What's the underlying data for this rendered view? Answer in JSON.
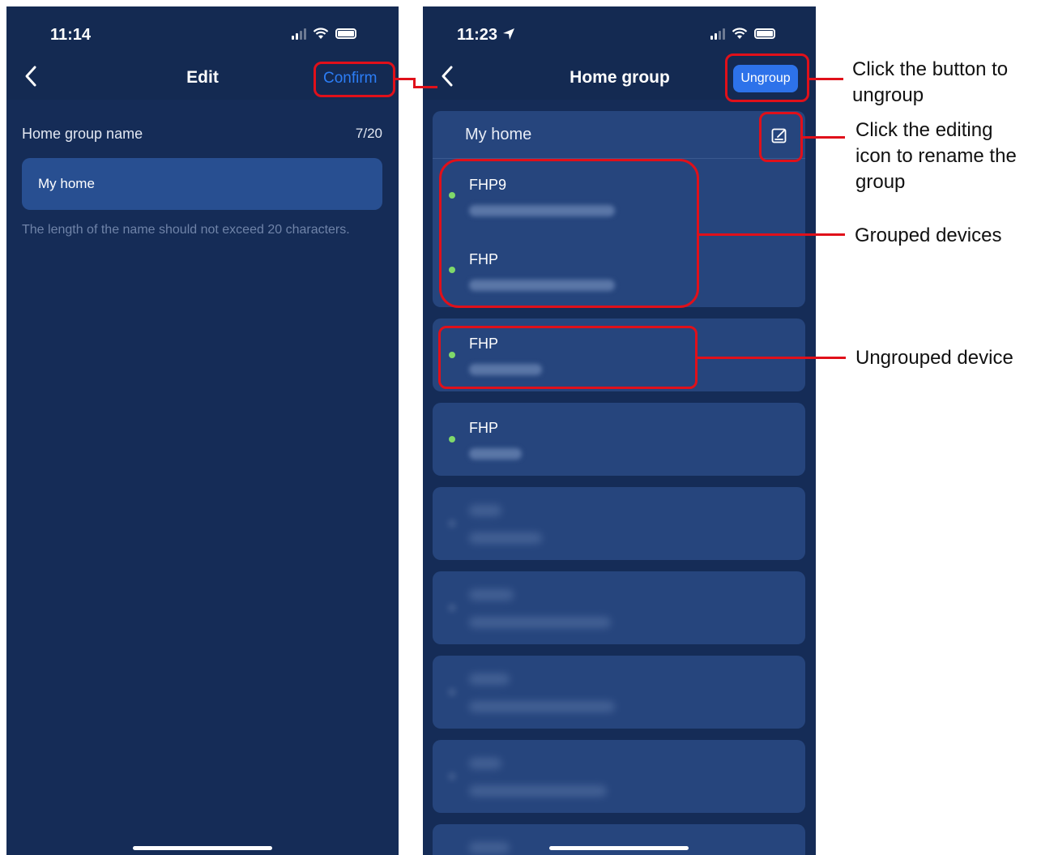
{
  "left_screen": {
    "time": "11:14",
    "nav_title": "Edit",
    "confirm_label": "Confirm",
    "field_label": "Home group name",
    "counter": "7/20",
    "input_value": "My home",
    "hint": "The length of the name should not exceed 20 characters."
  },
  "right_screen": {
    "time": "11:23",
    "nav_title": "Home group",
    "ungroup_label": "Ungroup",
    "group_name": "My home",
    "grouped_devices": [
      {
        "name": "FHP9"
      },
      {
        "name": "FHP"
      }
    ],
    "ungrouped_devices": [
      {
        "name": "FHP"
      },
      {
        "name": "FHP"
      }
    ]
  },
  "annotations": {
    "ungroup": "Click the button to ungroup",
    "rename": "Click the editing icon to rename the group",
    "grouped": "Grouped devices",
    "ungrouped": "Ungrouped device"
  },
  "colors": {
    "screen_bg": "#152c57",
    "card_bg": "#26457d",
    "accent": "#2d72ea",
    "online_dot": "#7fd96a",
    "annotation_red": "#e0101a"
  }
}
